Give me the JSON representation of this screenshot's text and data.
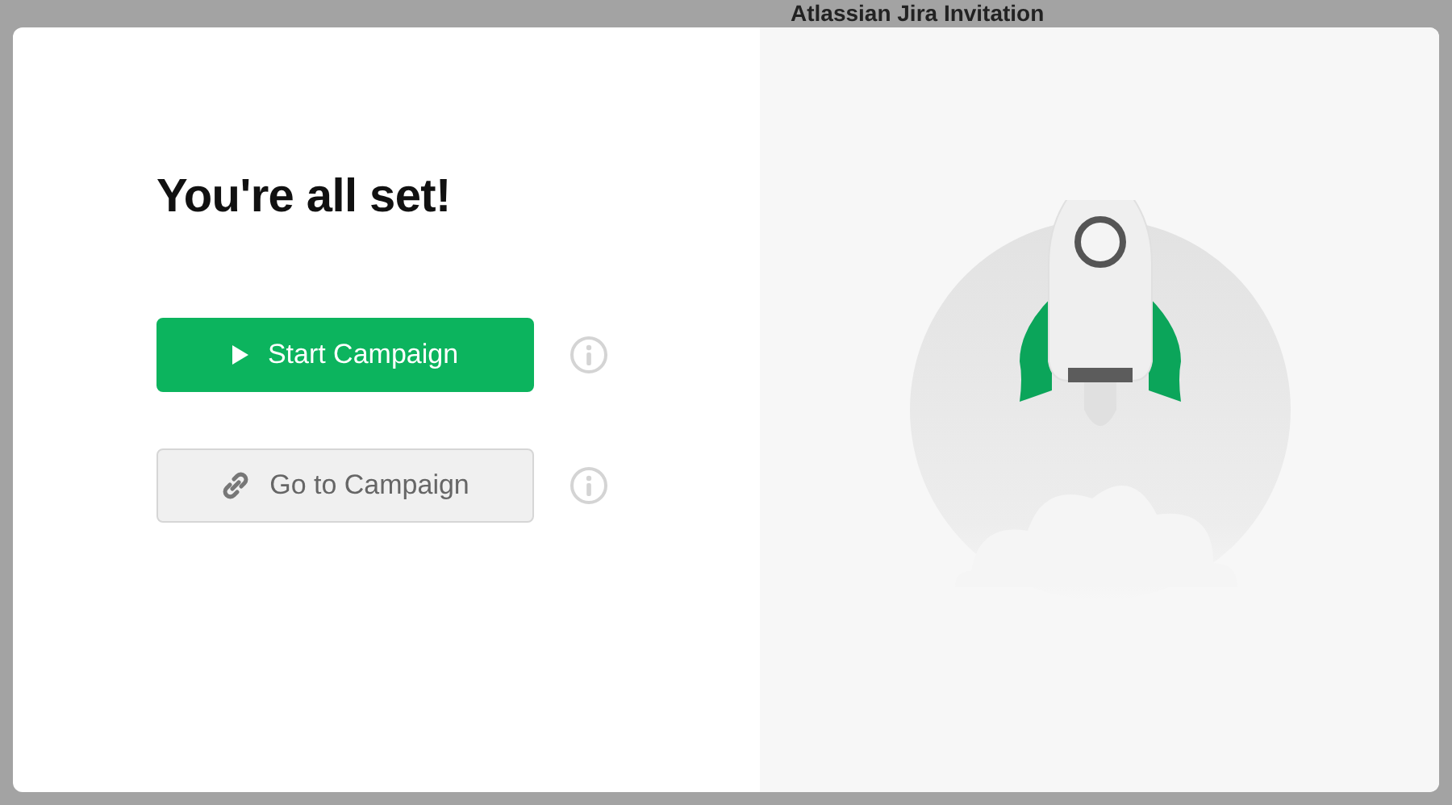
{
  "background": {
    "title": "Atlassian Jira Invitation"
  },
  "modal": {
    "title": "You're all set!",
    "buttons": [
      {
        "label": "Start Campaign",
        "kind": "primary"
      },
      {
        "label": "Go to Campaign",
        "kind": "secondary"
      }
    ]
  }
}
